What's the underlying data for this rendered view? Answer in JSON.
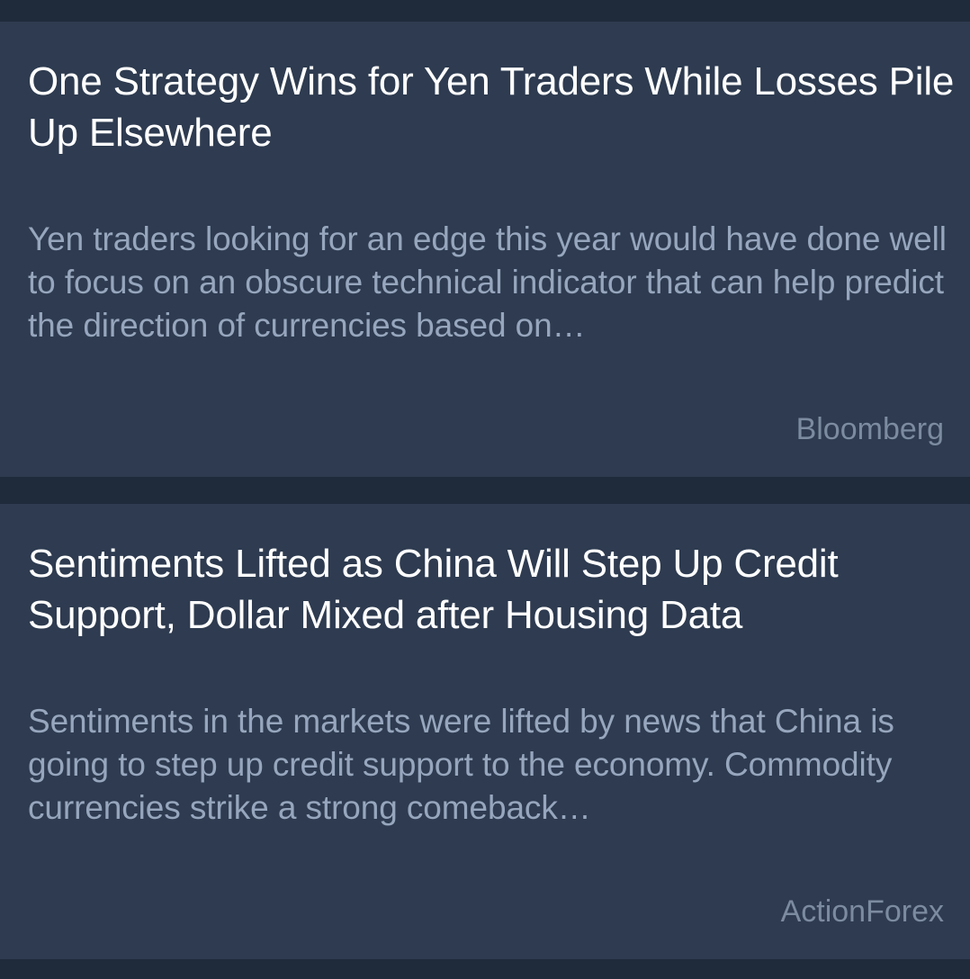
{
  "articles": [
    {
      "headline": "One Strategy Wins for Yen Traders While Losses Pile Up Elsewhere",
      "summary": "Yen traders looking for an edge this year would have done well to focus on an obscure technical indicator that can help predict the direction of currencies based on…",
      "source": "Bloomberg"
    },
    {
      "headline": "Sentiments Lifted as China Will Step Up Credit Support, Dollar Mixed after Housing Data",
      "summary": "Sentiments in the markets were lifted by news that China is going to step up credit support to the economy. Commodity currencies strike a strong comeback…",
      "source": "ActionForex"
    }
  ],
  "colors": {
    "page_background": "#1f2b3b",
    "card_background": "#2e3b50",
    "headline": "#ffffff",
    "summary": "#97a6bd",
    "source": "#7d8ba0"
  }
}
